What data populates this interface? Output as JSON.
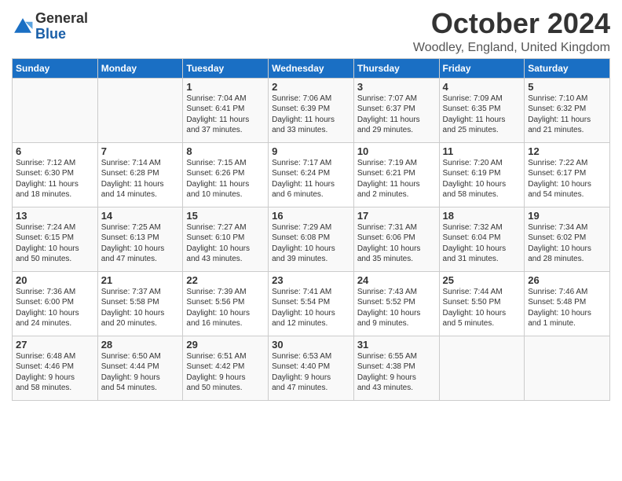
{
  "logo": {
    "general": "General",
    "blue": "Blue"
  },
  "title": "October 2024",
  "location": "Woodley, England, United Kingdom",
  "days_of_week": [
    "Sunday",
    "Monday",
    "Tuesday",
    "Wednesday",
    "Thursday",
    "Friday",
    "Saturday"
  ],
  "weeks": [
    [
      {
        "day": "",
        "text": ""
      },
      {
        "day": "",
        "text": ""
      },
      {
        "day": "1",
        "text": "Sunrise: 7:04 AM\nSunset: 6:41 PM\nDaylight: 11 hours\nand 37 minutes."
      },
      {
        "day": "2",
        "text": "Sunrise: 7:06 AM\nSunset: 6:39 PM\nDaylight: 11 hours\nand 33 minutes."
      },
      {
        "day": "3",
        "text": "Sunrise: 7:07 AM\nSunset: 6:37 PM\nDaylight: 11 hours\nand 29 minutes."
      },
      {
        "day": "4",
        "text": "Sunrise: 7:09 AM\nSunset: 6:35 PM\nDaylight: 11 hours\nand 25 minutes."
      },
      {
        "day": "5",
        "text": "Sunrise: 7:10 AM\nSunset: 6:32 PM\nDaylight: 11 hours\nand 21 minutes."
      }
    ],
    [
      {
        "day": "6",
        "text": "Sunrise: 7:12 AM\nSunset: 6:30 PM\nDaylight: 11 hours\nand 18 minutes."
      },
      {
        "day": "7",
        "text": "Sunrise: 7:14 AM\nSunset: 6:28 PM\nDaylight: 11 hours\nand 14 minutes."
      },
      {
        "day": "8",
        "text": "Sunrise: 7:15 AM\nSunset: 6:26 PM\nDaylight: 11 hours\nand 10 minutes."
      },
      {
        "day": "9",
        "text": "Sunrise: 7:17 AM\nSunset: 6:24 PM\nDaylight: 11 hours\nand 6 minutes."
      },
      {
        "day": "10",
        "text": "Sunrise: 7:19 AM\nSunset: 6:21 PM\nDaylight: 11 hours\nand 2 minutes."
      },
      {
        "day": "11",
        "text": "Sunrise: 7:20 AM\nSunset: 6:19 PM\nDaylight: 10 hours\nand 58 minutes."
      },
      {
        "day": "12",
        "text": "Sunrise: 7:22 AM\nSunset: 6:17 PM\nDaylight: 10 hours\nand 54 minutes."
      }
    ],
    [
      {
        "day": "13",
        "text": "Sunrise: 7:24 AM\nSunset: 6:15 PM\nDaylight: 10 hours\nand 50 minutes."
      },
      {
        "day": "14",
        "text": "Sunrise: 7:25 AM\nSunset: 6:13 PM\nDaylight: 10 hours\nand 47 minutes."
      },
      {
        "day": "15",
        "text": "Sunrise: 7:27 AM\nSunset: 6:10 PM\nDaylight: 10 hours\nand 43 minutes."
      },
      {
        "day": "16",
        "text": "Sunrise: 7:29 AM\nSunset: 6:08 PM\nDaylight: 10 hours\nand 39 minutes."
      },
      {
        "day": "17",
        "text": "Sunrise: 7:31 AM\nSunset: 6:06 PM\nDaylight: 10 hours\nand 35 minutes."
      },
      {
        "day": "18",
        "text": "Sunrise: 7:32 AM\nSunset: 6:04 PM\nDaylight: 10 hours\nand 31 minutes."
      },
      {
        "day": "19",
        "text": "Sunrise: 7:34 AM\nSunset: 6:02 PM\nDaylight: 10 hours\nand 28 minutes."
      }
    ],
    [
      {
        "day": "20",
        "text": "Sunrise: 7:36 AM\nSunset: 6:00 PM\nDaylight: 10 hours\nand 24 minutes."
      },
      {
        "day": "21",
        "text": "Sunrise: 7:37 AM\nSunset: 5:58 PM\nDaylight: 10 hours\nand 20 minutes."
      },
      {
        "day": "22",
        "text": "Sunrise: 7:39 AM\nSunset: 5:56 PM\nDaylight: 10 hours\nand 16 minutes."
      },
      {
        "day": "23",
        "text": "Sunrise: 7:41 AM\nSunset: 5:54 PM\nDaylight: 10 hours\nand 12 minutes."
      },
      {
        "day": "24",
        "text": "Sunrise: 7:43 AM\nSunset: 5:52 PM\nDaylight: 10 hours\nand 9 minutes."
      },
      {
        "day": "25",
        "text": "Sunrise: 7:44 AM\nSunset: 5:50 PM\nDaylight: 10 hours\nand 5 minutes."
      },
      {
        "day": "26",
        "text": "Sunrise: 7:46 AM\nSunset: 5:48 PM\nDaylight: 10 hours\nand 1 minute."
      }
    ],
    [
      {
        "day": "27",
        "text": "Sunrise: 6:48 AM\nSunset: 4:46 PM\nDaylight: 9 hours\nand 58 minutes."
      },
      {
        "day": "28",
        "text": "Sunrise: 6:50 AM\nSunset: 4:44 PM\nDaylight: 9 hours\nand 54 minutes."
      },
      {
        "day": "29",
        "text": "Sunrise: 6:51 AM\nSunset: 4:42 PM\nDaylight: 9 hours\nand 50 minutes."
      },
      {
        "day": "30",
        "text": "Sunrise: 6:53 AM\nSunset: 4:40 PM\nDaylight: 9 hours\nand 47 minutes."
      },
      {
        "day": "31",
        "text": "Sunrise: 6:55 AM\nSunset: 4:38 PM\nDaylight: 9 hours\nand 43 minutes."
      },
      {
        "day": "",
        "text": ""
      },
      {
        "day": "",
        "text": ""
      }
    ]
  ]
}
